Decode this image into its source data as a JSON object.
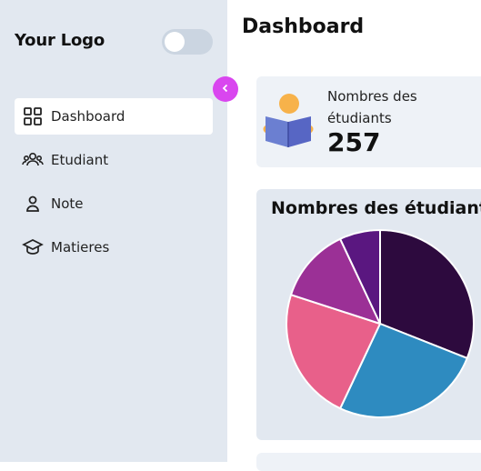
{
  "sidebar": {
    "logo": "Your Logo",
    "toggle_on": false,
    "items": [
      {
        "label": "Dashboard",
        "icon": "grid-icon",
        "active": true
      },
      {
        "label": "Etudiant",
        "icon": "users-icon",
        "active": false
      },
      {
        "label": "Note",
        "icon": "user-icon",
        "active": false
      },
      {
        "label": "Matieres",
        "icon": "graduation-cap-icon",
        "active": false
      }
    ],
    "collapse_button_color": "#d946ef"
  },
  "main": {
    "title": "Dashboard",
    "stat": {
      "label": "Nombres des étudiants",
      "value": "257"
    },
    "chart_title": "Nombres des étudiants"
  },
  "chart_data": {
    "type": "pie",
    "title": "Nombres des étudiants",
    "slices": [
      {
        "value": 31,
        "color": "#2d0a3e"
      },
      {
        "value": 26,
        "color": "#2e8bc0"
      },
      {
        "value": 23,
        "color": "#e8608a"
      },
      {
        "value": 13,
        "color": "#9b3096"
      },
      {
        "value": 7,
        "color": "#5a1780"
      }
    ]
  }
}
